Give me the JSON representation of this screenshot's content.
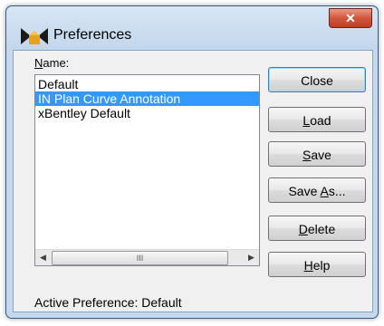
{
  "dialog": {
    "title": "Preferences",
    "close_glyph": "✕"
  },
  "name_label": {
    "before": "",
    "mnemonic": "N",
    "after": "ame:"
  },
  "list": {
    "items": [
      {
        "label": "Default",
        "selected": false
      },
      {
        "label": "IN Plan Curve Annotation",
        "selected": true
      },
      {
        "label": "xBentley Default",
        "selected": false
      }
    ],
    "scroll_thumb_glyph": "III"
  },
  "buttons": {
    "close": {
      "before": "Close",
      "mnemonic": "",
      "after": ""
    },
    "load": {
      "before": "",
      "mnemonic": "L",
      "after": "oad"
    },
    "save": {
      "before": "",
      "mnemonic": "S",
      "after": "ave"
    },
    "save_as": {
      "before": "Save ",
      "mnemonic": "A",
      "after": "s..."
    },
    "delete": {
      "before": "",
      "mnemonic": "D",
      "after": "elete"
    },
    "help": {
      "before": "",
      "mnemonic": "H",
      "after": "elp"
    }
  },
  "active_preference": "Active Preference: Default",
  "colors": {
    "selection": "#3399ff",
    "window_frame": "#c5d9ee",
    "close_button": "#d3573c"
  },
  "icons": {
    "app": "bentley-preferences-icon",
    "close": "close-icon",
    "scroll_left": "scroll-left-arrow-icon",
    "scroll_right": "scroll-right-arrow-icon"
  }
}
